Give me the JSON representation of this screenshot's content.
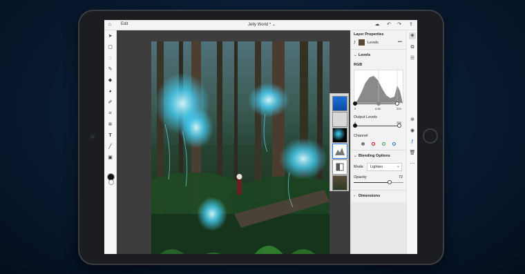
{
  "app": {
    "edit_label": "Edit",
    "doc_title": "Jelly World *",
    "title_chevron": "⌄"
  },
  "topbar_icons": [
    "home-icon",
    "cloud-icon",
    "undo-icon",
    "redo-icon",
    "share-icon"
  ],
  "left_tools": [
    "move-icon",
    "select-icon",
    "lasso-icon",
    "brush-icon",
    "eraser-icon",
    "fill-icon",
    "healing-icon",
    "crop-icon",
    "stamp-icon",
    "type-icon",
    "line-icon",
    "place-image-icon"
  ],
  "layer_properties": {
    "title": "Layer Properties",
    "layer_name": "Levels",
    "menu": "•••"
  },
  "levels": {
    "section": "Levels",
    "channel_label": "RGB",
    "input_low": "0",
    "input_mid": "0.96",
    "input_high": "224",
    "output_label": "Output Levels",
    "output_low": "0",
    "output_high": "255",
    "channel_title": "Channel"
  },
  "blending": {
    "section": "Blending Options",
    "mode_label": "Mode",
    "mode_value": "Lighten",
    "opacity_label": "Opacity",
    "opacity_value": "72",
    "opacity": 0.72
  },
  "dimensions": {
    "section": "Dimensions"
  },
  "right_icons": [
    "layers-icon",
    "properties-icon",
    "adjustments-icon",
    "add-icon",
    "visibility-icon",
    "link-icon",
    "delete-icon",
    "more-icon"
  ],
  "colors": {
    "accent": "#1473e6",
    "channel_gray": "#777777",
    "channel_red": "#d0021b",
    "channel_green": "#2e9e44",
    "channel_blue": "#1a6fd6",
    "glow": "#46d6ff"
  }
}
